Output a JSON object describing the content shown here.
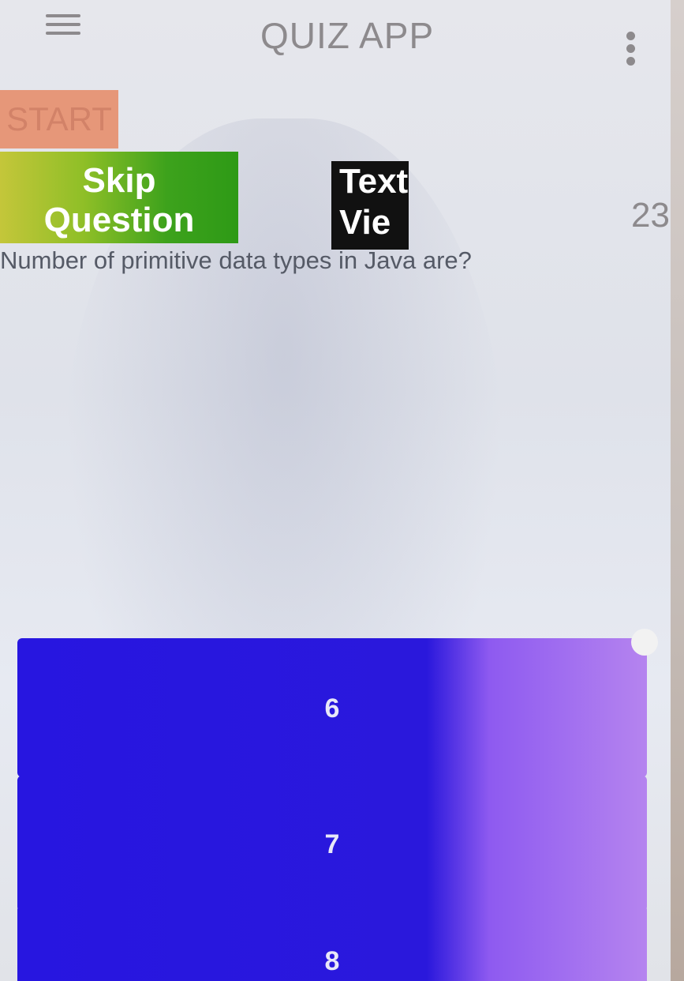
{
  "app_bar": {
    "title": "QUIZ APP",
    "menu_icon": "hamburger-icon",
    "overflow_icon": "more-vertical-icon"
  },
  "controls": {
    "start_label": "START",
    "skip_label_line1": "Skip",
    "skip_label_line2": "Question",
    "textview_label": "TextVie"
  },
  "score": "23",
  "question": {
    "text": "Number of primitive data types in Java are?"
  },
  "options": [
    {
      "label": "6"
    },
    {
      "label": "7"
    },
    {
      "label": "8"
    }
  ],
  "colors": {
    "start_bg": "#e69779",
    "skip_bg": "#3da21c",
    "option_bg": "#2716e0",
    "textview_bg": "#111111"
  }
}
